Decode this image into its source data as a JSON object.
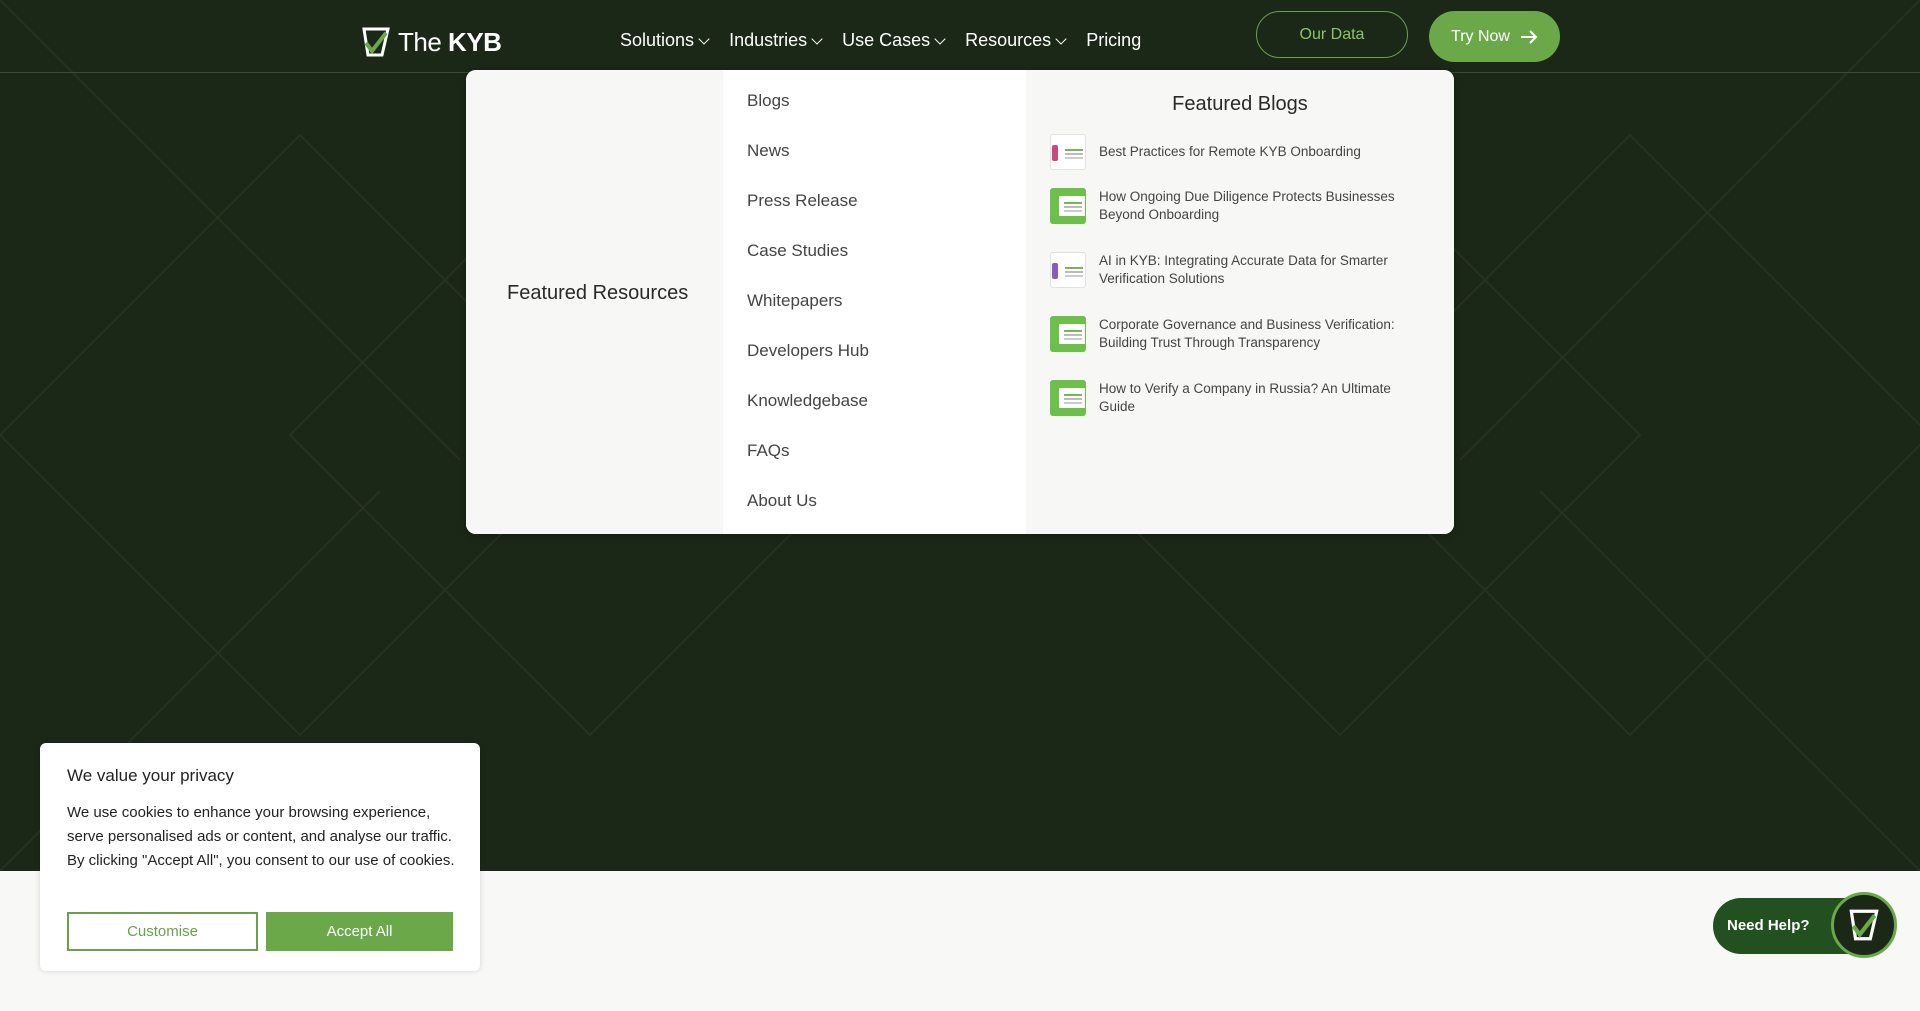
{
  "header": {
    "logo_prefix": "The",
    "logo_brand": "KYB",
    "nav": [
      {
        "label": "Solutions",
        "has_dropdown": true
      },
      {
        "label": "Industries",
        "has_dropdown": true
      },
      {
        "label": "Use Cases",
        "has_dropdown": true
      },
      {
        "label": "Resources",
        "has_dropdown": true
      },
      {
        "label": "Pricing",
        "has_dropdown": false
      }
    ],
    "our_data_label": "Our Data",
    "try_now_label": "Try Now"
  },
  "resources_menu": {
    "featured_resources_title": "Featured Resources",
    "links": [
      "Blogs",
      "News",
      "Press Release",
      "Case Studies",
      "Whitepapers",
      "Developers Hub",
      "Knowledgebase",
      "FAQs",
      "About Us"
    ],
    "featured_blogs_title": "Featured Blogs",
    "blogs": [
      {
        "title": "Best Practices for Remote KYB Onboarding",
        "thumb": "white"
      },
      {
        "title": "How Ongoing Due Diligence Protects Businesses Beyond Onboarding",
        "thumb": "green"
      },
      {
        "title": "AI in KYB: Integrating Accurate Data for Smarter Verification Solutions",
        "thumb": "white"
      },
      {
        "title": "Corporate Governance and Business Verification: Building Trust Through Transparency",
        "thumb": "green"
      },
      {
        "title": "How to Verify a Company in Russia? An Ultimate Guide",
        "thumb": "green"
      }
    ]
  },
  "cookie_banner": {
    "title": "We value your privacy",
    "body": "We use cookies to enhance your browsing experience, serve personalised ads or content, and analyse our traffic. By clicking \"Accept All\", you consent to our use of cookies.",
    "customise_label": "Customise",
    "accept_label": "Accept All"
  },
  "help_widget": {
    "label": "Need Help?"
  },
  "colors": {
    "brand_green": "#6aa84a",
    "hero_bg": "#1b2717",
    "help_bg": "#23501f"
  }
}
